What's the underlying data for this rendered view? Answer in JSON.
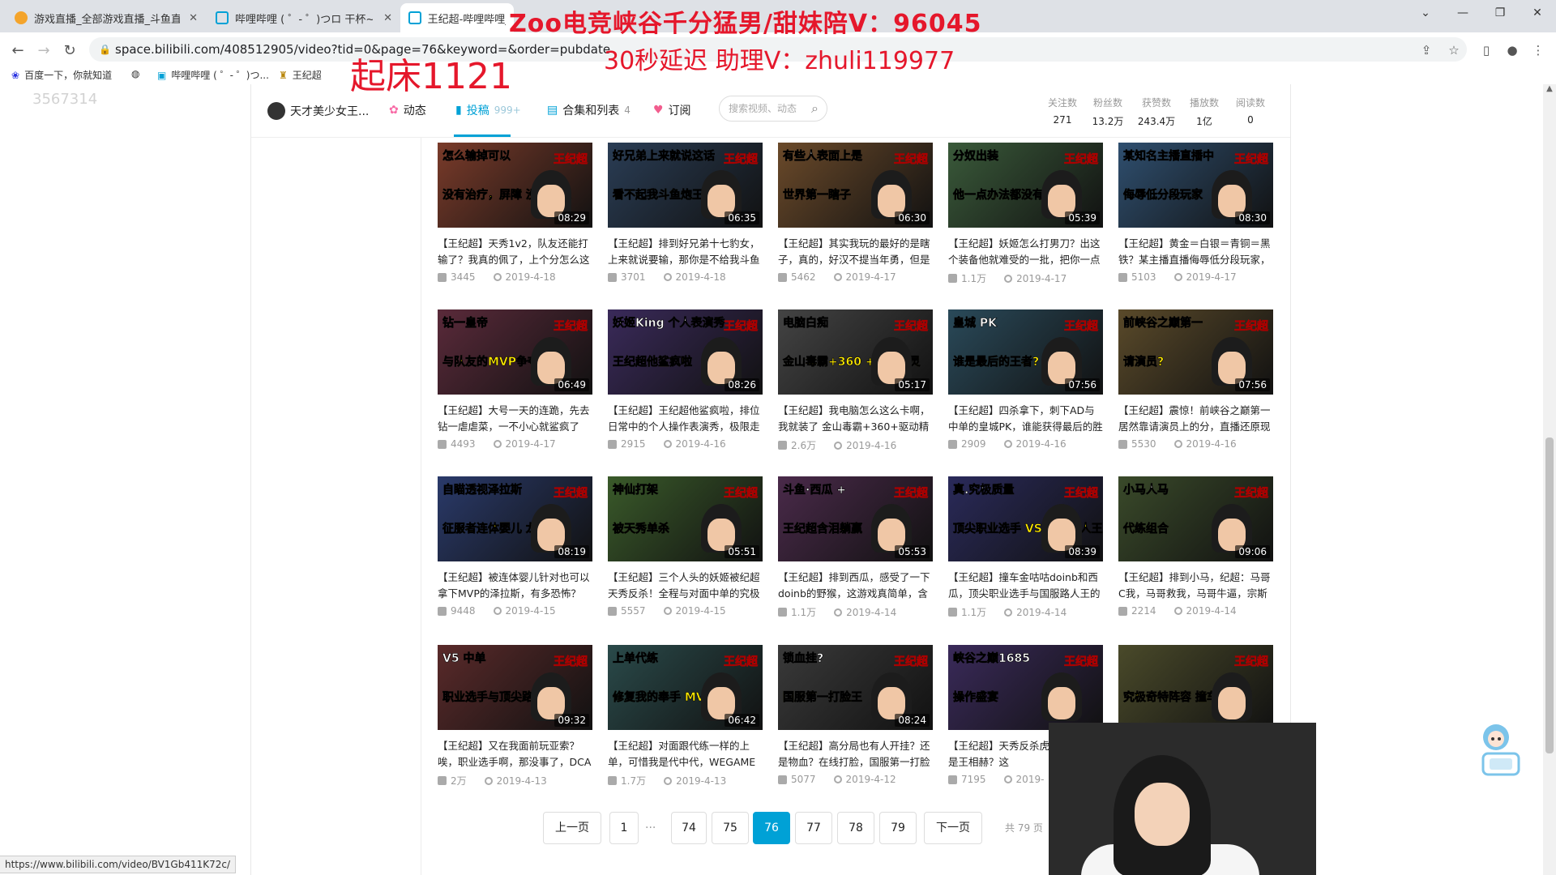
{
  "browser": {
    "tabs": [
      {
        "label": "游戏直播_全部游戏直播_斗鱼直播",
        "active": false
      },
      {
        "label": "哔哩哔哩 ( ゜- ゜)つロ 干杯~-bili",
        "active": false
      },
      {
        "label": "王纪超-哔哩哔哩_Bi",
        "active": true
      }
    ],
    "url": "space.bilibili.com/408512905/video?tid=0&page=76&keyword=&order=pubdate",
    "bookmarks": [
      "百度一下，你就知道",
      "哔哩哔哩 ( ゜- ゜)つ...",
      "王纪超"
    ],
    "status_url": "https://www.bilibili.com/video/BV1Gb411K72c/"
  },
  "overlay": {
    "line1": "Zoo电竞峡谷千分猛男/甜妹陪V：96045",
    "line2": "起床1121",
    "line3": "30秒延迟  助理V：zhuli119977",
    "room_id": "3567314"
  },
  "nav": {
    "username": "天才美少女王...",
    "items": [
      {
        "label": "动态",
        "count": ""
      },
      {
        "label": "投稿",
        "count": "999+"
      },
      {
        "label": "合集和列表",
        "count": "4"
      },
      {
        "label": "订阅",
        "count": ""
      }
    ],
    "search_placeholder": "搜索视频、动态",
    "stats": [
      {
        "label": "关注数",
        "value": "271"
      },
      {
        "label": "粉丝数",
        "value": "13.2万"
      },
      {
        "label": "获赞数",
        "value": "243.4万"
      },
      {
        "label": "播放数",
        "value": "1亿"
      },
      {
        "label": "阅读数",
        "value": "0"
      }
    ]
  },
  "videos": [
    {
      "duration": "08:29",
      "title": "【王纪超】天秀1v2，队友还能打输了？我真的佩了，上个分怎么这么",
      "plays": "3445",
      "date": "2019-4-18",
      "caption_top": "怎么输掉可以",
      "caption_bottom": "没有治疗，屏障 没有秒表",
      "color": "#7a3b2a"
    },
    {
      "duration": "06:35",
      "title": "【王纪超】排到好兄弟十七豹女，上来就说要输，那你是不给我斗鱼",
      "plays": "3701",
      "date": "2019-4-18",
      "caption_top": "好兄弟上来就说这话",
      "caption_bottom": "看不起我斗鱼炮王？",
      "color": "#2a3d55"
    },
    {
      "duration": "06:30",
      "title": "【王纪超】其实我玩的最好的是瞎子，真的，好汉不提当年勇，但是",
      "plays": "5462",
      "date": "2019-4-17",
      "caption_top": "有些人表面上是",
      "caption_bottom": "世界第一瞎子",
      "color": "#6b4a2a"
    },
    {
      "duration": "05:39",
      "title": "【王纪超】妖姬怎么打男刀？出这个装备他就难受的一批，把你一点",
      "plays": "1.1万",
      "date": "2019-4-17",
      "caption_top": "分奴出装",
      "caption_bottom": "他一点办法都没有",
      "color": "#3a5a3a"
    },
    {
      "duration": "08:30",
      "title": "【王纪超】黄金＝白银＝青铜＝黑铁？某主播直播侮辱低分段玩家，",
      "plays": "5103",
      "date": "2019-4-17",
      "caption_top": "某知名主播直播中",
      "caption_bottom": "侮辱低分段玩家",
      "color": "#2f4f6f"
    },
    {
      "duration": "06:49",
      "title": "【王纪超】大号一天的连跪，先去钻一虐虐菜，一不小心就鲨疯了",
      "plays": "4493",
      "date": "2019-4-17",
      "caption_top": "钻一皇帝",
      "caption_bottom": "与队友的MVP争夺战",
      "color": "#5a2a3a"
    },
    {
      "duration": "08:26",
      "title": "【王纪超】王纪超他鲨疯啦，排位日常中的个人操作表演秀，极限走",
      "plays": "2915",
      "date": "2019-4-16",
      "caption_top": "妖姬King 个人表演秀",
      "caption_bottom": "王纪超他鲨疯啦",
      "color": "#3a2a5a"
    },
    {
      "duration": "05:17",
      "title": "【王纪超】我电脑怎么这么卡啊，我就装了 金山毒霸+360+驱动精灵",
      "plays": "2.6万",
      "date": "2019-4-16",
      "caption_top": "电脑白痴",
      "caption_bottom": "金山毒霸+360 +驱动精灵",
      "color": "#444444"
    },
    {
      "duration": "07:56",
      "title": "【王纪超】四杀拿下，刺下AD与中单的皇城PK，谁能获得最后的胜",
      "plays": "2909",
      "date": "2019-4-16",
      "caption_top": "皇城 PK",
      "caption_bottom": "谁是最后的王者?",
      "color": "#2a4a5a"
    },
    {
      "duration": "07:56",
      "title": "【王纪超】震惊！前峡谷之巅第一居然靠请演员上的分，直播还原现",
      "plays": "5530",
      "date": "2019-4-16",
      "caption_top": "前峡谷之巅第一",
      "caption_bottom": "请演员?",
      "color": "#5a4a2a"
    },
    {
      "duration": "08:19",
      "title": "【王纪超】被连体婴儿针对也可以拿下MVP的泽拉斯，有多恐怖？",
      "plays": "9448",
      "date": "2019-4-15",
      "caption_top": "自瞄透视泽拉斯",
      "caption_bottom": "征服者连体婴儿 龙王",
      "color": "#2a3a6a"
    },
    {
      "duration": "05:51",
      "title": "【王纪超】三个人头的妖姬被纪超天秀反杀！全程与对面中单的究极",
      "plays": "5557",
      "date": "2019-4-15",
      "caption_top": "神仙打架",
      "caption_bottom": "被天秀单杀",
      "color": "#3a5a2a"
    },
    {
      "duration": "05:53",
      "title": "【王纪超】排到西瓜，感受了一下doinb的野猴，这游戏真简单，含泪",
      "plays": "1.1万",
      "date": "2019-4-14",
      "caption_top": "斗鱼·西瓜 +",
      "caption_bottom": "王纪超含泪躺赢",
      "color": "#4a2a4a"
    },
    {
      "duration": "08:39",
      "title": "【王纪超】撞车金咕咕doinb和西瓜，顶尖职业选手与国服路人王的",
      "plays": "1.1万",
      "date": "2019-4-14",
      "caption_top": "真.究极质量",
      "caption_bottom": "顶尖职业选手 VS 国服路人王",
      "color": "#2a2a5a"
    },
    {
      "duration": "09:06",
      "title": "【王纪超】排到小马，纪超：马哥C我，马哥救我，马哥牛逼，宗斯马",
      "plays": "2214",
      "date": "2019-4-14",
      "caption_top": "小马人马",
      "caption_bottom": "代练组合",
      "color": "#3a4a2a"
    },
    {
      "duration": "09:32",
      "title": "【王纪超】又在我面前玩亚索？唉，职业选手啊，那没事了，DCA",
      "plays": "2万",
      "date": "2019-4-13",
      "caption_top": "V5 中单",
      "caption_bottom": "职业选手与顶尖路人",
      "color": "#5a2a2a"
    },
    {
      "duration": "06:42",
      "title": "【王纪超】对面跟代练一样的上单，可惜我是代中代，WEGAME就",
      "plays": "1.7万",
      "date": "2019-4-13",
      "caption_top": "上单代练",
      "caption_bottom": "修复我的奉手 MVP拿下",
      "color": "#2a4a4a"
    },
    {
      "duration": "08:24",
      "title": "【王纪超】高分局也有人开挂？还是物血？在线打脸，国服第一打脸",
      "plays": "5077",
      "date": "2019-4-12",
      "caption_top": "锁血挂?",
      "caption_bottom": "国服第一打脸王",
      "color": "#3a3a3a"
    },
    {
      "duration": "",
      "title": "【王纪超】天秀反杀虎妖伊，你就是王相赫？这",
      "plays": "7195",
      "date": "2019-",
      "caption_top": "峡谷之巅1685",
      "caption_bottom": "操作盛宴",
      "color": "#3a2a5a"
    },
    {
      "duration": "",
      "title": "",
      "plays": "",
      "date": "",
      "caption_top": "",
      "caption_bottom": "究极奇特阵容 撞车古手羽",
      "color": "#4a4a2a"
    }
  ],
  "pagination": {
    "prev": "上一页",
    "first": "1",
    "ellipsis": "···",
    "pages": [
      "74",
      "75",
      "76",
      "77",
      "78",
      "79"
    ],
    "active": "76",
    "next": "下一页",
    "total": "共 79 页"
  },
  "tag_label": "王纪超"
}
